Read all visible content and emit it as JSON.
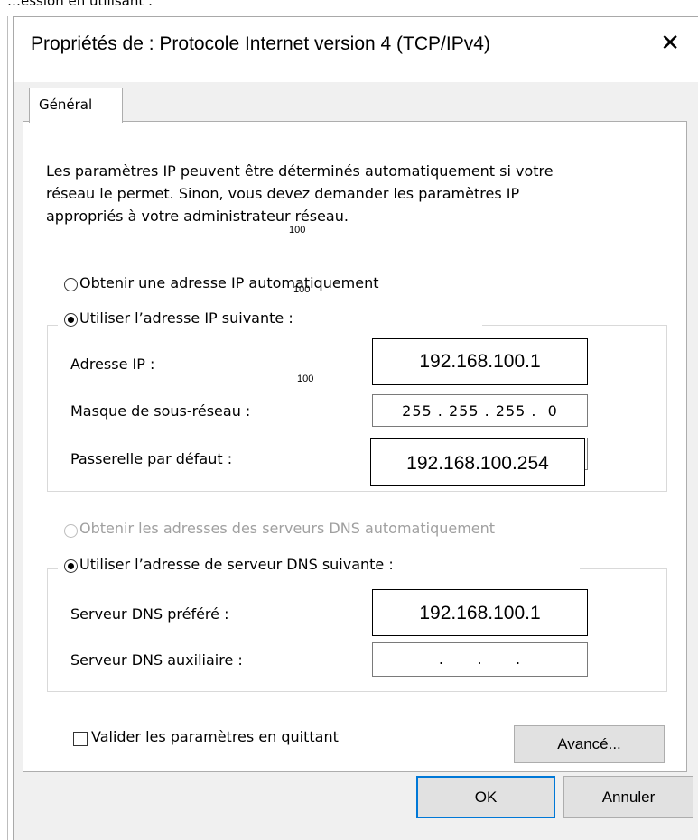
{
  "background": {
    "partial_text": "…ession en utilisant :"
  },
  "dialog": {
    "title": "Propriétés de : Protocole Internet version 4 (TCP/IPv4)",
    "close_glyph": "✕"
  },
  "tabs": [
    {
      "label": "Général"
    }
  ],
  "general": {
    "description_lines": [
      "Les paramètres IP peuvent être déterminés automatiquement si votre",
      "réseau le permet. Sinon, vous devez demander les paramètres IP",
      "appropriés à votre administrateur réseau."
    ],
    "ip": {
      "auto_label": "Obtenir une adresse IP automatiquement",
      "auto_selected": false,
      "manual_label": "Utiliser l’adresse IP suivante :",
      "manual_selected": true,
      "fields": {
        "address": {
          "label": "Adresse IP :",
          "value": "192.168.100.1"
        },
        "subnet": {
          "label": "Masque de sous-réseau :",
          "value": "255 . 255 . 255 .  0"
        },
        "gateway": {
          "label": "Passerelle par défaut :",
          "value": "192.168.100.254"
        }
      }
    },
    "dns": {
      "auto_label": "Obtenir les adresses des serveurs DNS automatiquement",
      "auto_selected": false,
      "auto_disabled": true,
      "manual_label": "Utiliser l’adresse de serveur DNS suivante :",
      "manual_selected": true,
      "fields": {
        "preferred": {
          "label": "Serveur DNS préféré :",
          "value": "192.168.100.1"
        },
        "alternate": {
          "label": "Serveur DNS auxiliaire :",
          "value": ".      .      ."
        }
      }
    },
    "validate_on_exit": {
      "label": "Valider les paramètres en quittant",
      "checked": false
    },
    "advanced_button": "Avancé..."
  },
  "footer": {
    "ok": "OK",
    "cancel": "Annuler"
  },
  "annotations": [
    "100",
    "100",
    "100"
  ],
  "colors": {
    "accent": "#0078d7",
    "window_bg": "#f0f0f0",
    "panel_bg": "#ffffff",
    "disabled_text": "#a0a0a0"
  }
}
